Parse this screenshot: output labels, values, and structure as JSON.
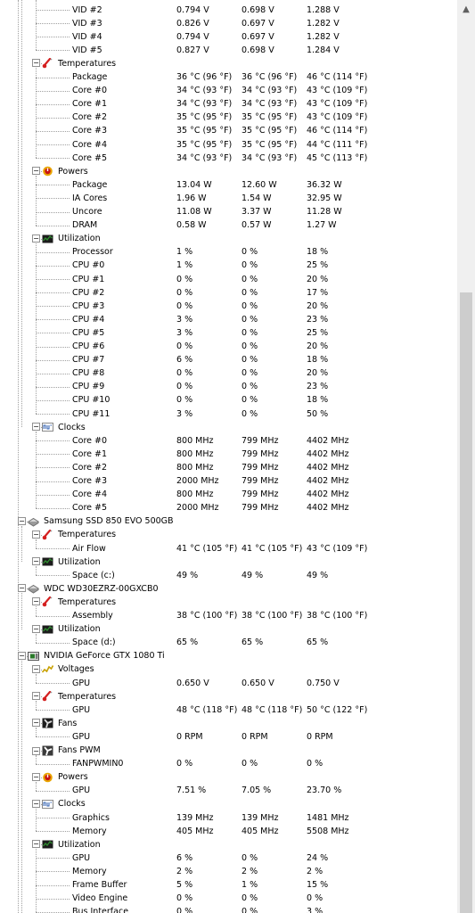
{
  "tree": {
    "rows": [
      {
        "level": 4,
        "label": "VID #2",
        "v": [
          "0.794 V",
          "0.698 V",
          "1.288 V"
        ]
      },
      {
        "level": 4,
        "label": "VID #3",
        "v": [
          "0.826 V",
          "0.697 V",
          "1.282 V"
        ]
      },
      {
        "level": 4,
        "label": "VID #4",
        "v": [
          "0.794 V",
          "0.697 V",
          "1.282 V"
        ]
      },
      {
        "level": 4,
        "label": "VID #5",
        "v": [
          "0.827 V",
          "0.698 V",
          "1.284 V"
        ]
      },
      {
        "level": 3,
        "label": "Temperatures",
        "icon": "thermometer-icon",
        "toggle": "minus",
        "last": false
      },
      {
        "level": 4,
        "label": "Package",
        "v": [
          "36 °C  (96 °F)",
          "36 °C  (96 °F)",
          "46 °C  (114 °F)"
        ]
      },
      {
        "level": 4,
        "label": "Core #0",
        "v": [
          "34 °C  (93 °F)",
          "34 °C  (93 °F)",
          "43 °C  (109 °F)"
        ]
      },
      {
        "level": 4,
        "label": "Core #1",
        "v": [
          "34 °C  (93 °F)",
          "34 °C  (93 °F)",
          "43 °C  (109 °F)"
        ]
      },
      {
        "level": 4,
        "label": "Core #2",
        "v": [
          "35 °C  (95 °F)",
          "35 °C  (95 °F)",
          "43 °C  (109 °F)"
        ]
      },
      {
        "level": 4,
        "label": "Core #3",
        "v": [
          "35 °C  (95 °F)",
          "35 °C  (95 °F)",
          "46 °C  (114 °F)"
        ]
      },
      {
        "level": 4,
        "label": "Core #4",
        "v": [
          "35 °C  (95 °F)",
          "35 °C  (95 °F)",
          "44 °C  (111 °F)"
        ]
      },
      {
        "level": 4,
        "label": "Core #5",
        "v": [
          "34 °C  (93 °F)",
          "34 °C  (93 °F)",
          "45 °C  (113 °F)"
        ]
      },
      {
        "level": 3,
        "label": "Powers",
        "icon": "power-icon",
        "toggle": "minus",
        "last": false
      },
      {
        "level": 4,
        "label": "Package",
        "v": [
          "13.04 W",
          "12.60 W",
          "36.32 W"
        ]
      },
      {
        "level": 4,
        "label": "IA Cores",
        "v": [
          "1.96 W",
          "1.54 W",
          "32.95 W"
        ]
      },
      {
        "level": 4,
        "label": "Uncore",
        "v": [
          "11.08 W",
          "3.37 W",
          "11.28 W"
        ]
      },
      {
        "level": 4,
        "label": "DRAM",
        "v": [
          "0.58 W",
          "0.57 W",
          "1.27 W"
        ]
      },
      {
        "level": 3,
        "label": "Utilization",
        "icon": "utilization-icon",
        "toggle": "minus",
        "last": false
      },
      {
        "level": 4,
        "label": "Processor",
        "v": [
          "1 %",
          "0 %",
          "18 %"
        ]
      },
      {
        "level": 4,
        "label": "CPU #0",
        "v": [
          "1 %",
          "0 %",
          "25 %"
        ]
      },
      {
        "level": 4,
        "label": "CPU #1",
        "v": [
          "0 %",
          "0 %",
          "20 %"
        ]
      },
      {
        "level": 4,
        "label": "CPU #2",
        "v": [
          "0 %",
          "0 %",
          "17 %"
        ]
      },
      {
        "level": 4,
        "label": "CPU #3",
        "v": [
          "0 %",
          "0 %",
          "20 %"
        ]
      },
      {
        "level": 4,
        "label": "CPU #4",
        "v": [
          "3 %",
          "0 %",
          "23 %"
        ]
      },
      {
        "level": 4,
        "label": "CPU #5",
        "v": [
          "3 %",
          "0 %",
          "25 %"
        ]
      },
      {
        "level": 4,
        "label": "CPU #6",
        "v": [
          "0 %",
          "0 %",
          "20 %"
        ]
      },
      {
        "level": 4,
        "label": "CPU #7",
        "v": [
          "6 %",
          "0 %",
          "18 %"
        ]
      },
      {
        "level": 4,
        "label": "CPU #8",
        "v": [
          "0 %",
          "0 %",
          "20 %"
        ]
      },
      {
        "level": 4,
        "label": "CPU #9",
        "v": [
          "0 %",
          "0 %",
          "23 %"
        ]
      },
      {
        "level": 4,
        "label": "CPU #10",
        "v": [
          "0 %",
          "0 %",
          "18 %"
        ]
      },
      {
        "level": 4,
        "label": "CPU #11",
        "v": [
          "3 %",
          "0 %",
          "50 %"
        ]
      },
      {
        "level": 3,
        "label": "Clocks",
        "icon": "clock-icon",
        "toggle": "minus",
        "last": true
      },
      {
        "level": 4,
        "label": "Core #0",
        "v": [
          "800 MHz",
          "799 MHz",
          "4402 MHz"
        ]
      },
      {
        "level": 4,
        "label": "Core #1",
        "v": [
          "800 MHz",
          "799 MHz",
          "4402 MHz"
        ]
      },
      {
        "level": 4,
        "label": "Core #2",
        "v": [
          "800 MHz",
          "799 MHz",
          "4402 MHz"
        ]
      },
      {
        "level": 4,
        "label": "Core #3",
        "v": [
          "2000 MHz",
          "799 MHz",
          "4402 MHz"
        ]
      },
      {
        "level": 4,
        "label": "Core #4",
        "v": [
          "800 MHz",
          "799 MHz",
          "4402 MHz"
        ]
      },
      {
        "level": 4,
        "label": "Core #5",
        "v": [
          "2000 MHz",
          "799 MHz",
          "4402 MHz"
        ]
      },
      {
        "level": 2,
        "label": "Samsung SSD 850 EVO 500GB",
        "icon": "drive-icon",
        "toggle": "minus"
      },
      {
        "level": 3,
        "label": "Temperatures",
        "icon": "thermometer-icon",
        "toggle": "minus",
        "last": false
      },
      {
        "level": 4,
        "label": "Air Flow",
        "v": [
          "41 °C  (105 °F)",
          "41 °C  (105 °F)",
          "43 °C  (109 °F)"
        ]
      },
      {
        "level": 3,
        "label": "Utilization",
        "icon": "utilization-icon",
        "toggle": "minus",
        "last": true
      },
      {
        "level": 4,
        "label": "Space (c:)",
        "v": [
          "49 %",
          "49 %",
          "49 %"
        ]
      },
      {
        "level": 2,
        "label": "WDC WD30EZRZ-00GXCB0",
        "icon": "drive-icon",
        "toggle": "minus"
      },
      {
        "level": 3,
        "label": "Temperatures",
        "icon": "thermometer-icon",
        "toggle": "minus",
        "last": false
      },
      {
        "level": 4,
        "label": "Assembly",
        "v": [
          "38 °C  (100 °F)",
          "38 °C  (100 °F)",
          "38 °C  (100 °F)"
        ]
      },
      {
        "level": 3,
        "label": "Utilization",
        "icon": "utilization-icon",
        "toggle": "minus",
        "last": true
      },
      {
        "level": 4,
        "label": "Space (d:)",
        "v": [
          "65 %",
          "65 %",
          "65 %"
        ]
      },
      {
        "level": 2,
        "label": "NVIDIA GeForce GTX 1080 Ti",
        "icon": "gpu-icon",
        "toggle": "minus"
      },
      {
        "level": 3,
        "label": "Voltages",
        "icon": "voltage-icon",
        "toggle": "minus",
        "last": false
      },
      {
        "level": 4,
        "label": "GPU",
        "v": [
          "0.650 V",
          "0.650 V",
          "0.750 V"
        ]
      },
      {
        "level": 3,
        "label": "Temperatures",
        "icon": "thermometer-icon",
        "toggle": "minus",
        "last": false
      },
      {
        "level": 4,
        "label": "GPU",
        "v": [
          "48 °C  (118 °F)",
          "48 °C  (118 °F)",
          "50 °C  (122 °F)"
        ]
      },
      {
        "level": 3,
        "label": "Fans",
        "icon": "fan-icon",
        "toggle": "minus",
        "last": false
      },
      {
        "level": 4,
        "label": "GPU",
        "v": [
          "0 RPM",
          "0 RPM",
          "0 RPM"
        ]
      },
      {
        "level": 3,
        "label": "Fans PWM",
        "icon": "fan-pwm-icon",
        "toggle": "minus",
        "last": false
      },
      {
        "level": 4,
        "label": "FANPWMIN0",
        "v": [
          "0 %",
          "0 %",
          "0 %"
        ]
      },
      {
        "level": 3,
        "label": "Powers",
        "icon": "power-icon",
        "toggle": "minus",
        "last": false
      },
      {
        "level": 4,
        "label": "GPU",
        "v": [
          "7.51 %",
          "7.05 %",
          "23.70 %"
        ]
      },
      {
        "level": 3,
        "label": "Clocks",
        "icon": "clock-icon",
        "toggle": "minus",
        "last": false
      },
      {
        "level": 4,
        "label": "Graphics",
        "v": [
          "139 MHz",
          "139 MHz",
          "1481 MHz"
        ]
      },
      {
        "level": 4,
        "label": "Memory",
        "v": [
          "405 MHz",
          "405 MHz",
          "5508 MHz"
        ]
      },
      {
        "level": 3,
        "label": "Utilization",
        "icon": "utilization-icon",
        "toggle": "minus",
        "last": false
      },
      {
        "level": 4,
        "label": "GPU",
        "v": [
          "6 %",
          "0 %",
          "24 %"
        ]
      },
      {
        "level": 4,
        "label": "Memory",
        "v": [
          "2 %",
          "2 %",
          "2 %"
        ]
      },
      {
        "level": 4,
        "label": "Frame Buffer",
        "v": [
          "5 %",
          "1 %",
          "15 %"
        ]
      },
      {
        "level": 4,
        "label": "Video Engine",
        "v": [
          "0 %",
          "0 %",
          "0 %"
        ]
      },
      {
        "level": 4,
        "label": "Bus Interface",
        "v": [
          "0 %",
          "0 %",
          "3 %"
        ]
      }
    ]
  },
  "colors": {
    "thermometer": "#d42020",
    "power_outer": "#e8a400",
    "power_inner": "#c81414",
    "utilization": "#2f8f2f",
    "clock": "#2f5fb0",
    "voltage": "#c8a000",
    "fan": "#303030",
    "gpu": "#2a7a2a",
    "drive": "#707070",
    "scroll_track": "#f0f0f0",
    "scroll_thumb": "#cdcdcd"
  },
  "scrollbar": {
    "up_arrow": "▲"
  }
}
